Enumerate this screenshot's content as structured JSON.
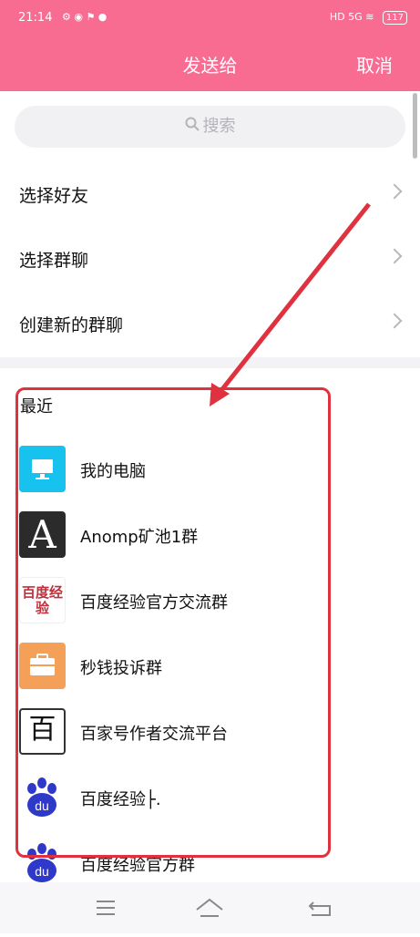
{
  "status": {
    "time": "21:14",
    "battery": "117",
    "network": "5G",
    "hd": "HD"
  },
  "header": {
    "title": "发送给",
    "cancel": "取消"
  },
  "search": {
    "placeholder": "搜索"
  },
  "menu": [
    {
      "label": "选择好友"
    },
    {
      "label": "选择群聊"
    },
    {
      "label": "创建新的群聊"
    }
  ],
  "recent": {
    "heading": "最近",
    "items": [
      {
        "name": "我的电脑",
        "icon": "computer-icon"
      },
      {
        "name": "Anomp矿池1群",
        "icon": "letter-a-avatar",
        "avatar_text": "A"
      },
      {
        "name": "百度经验官方交流群",
        "icon": "baidu-jingyan-logo",
        "avatar_text": "百度经验"
      },
      {
        "name": "秒钱投诉群",
        "icon": "briefcase-icon"
      },
      {
        "name": "百家号作者交流平台",
        "icon": "baijiahao-logo",
        "avatar_text": "百"
      },
      {
        "name": "百度经验├.",
        "icon": "baidu-paw-logo"
      },
      {
        "name": "百度经验官方群",
        "icon": "baidu-paw-logo"
      }
    ]
  },
  "colors": {
    "header": "#f96c92",
    "highlight": "#e0323e",
    "arrow": "#e0323e"
  }
}
